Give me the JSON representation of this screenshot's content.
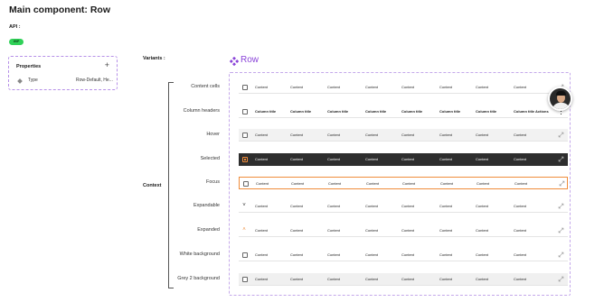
{
  "header": {
    "title": "Main component: Row",
    "api_label": "API :",
    "api_badge": "WIP"
  },
  "properties": {
    "title": "Properties",
    "add_icon": "plus-icon",
    "items": [
      {
        "key": "Type",
        "value": "Row-Default, He..."
      }
    ]
  },
  "variants": {
    "label": "Variants :",
    "component_title": "Row",
    "component_icon": "component-diamond-icon"
  },
  "context_label": "Context",
  "rows": [
    {
      "label": "Content cells",
      "type": "default"
    },
    {
      "label": "Column headers",
      "type": "header"
    },
    {
      "label": "Hover",
      "type": "hover"
    },
    {
      "label": "Selected",
      "type": "selected"
    },
    {
      "label": "Focus",
      "type": "focus"
    },
    {
      "label": "Expandable",
      "type": "expandable"
    },
    {
      "label": "Expanded",
      "type": "expanded"
    },
    {
      "label": "White background",
      "type": "white"
    },
    {
      "label": "Grey 2 background",
      "type": "grey"
    }
  ],
  "cell_text": "Content",
  "header_text": "Column title",
  "actions_text": "Actions",
  "colors": {
    "accent_purple": "#8a44d8",
    "focus_orange": "#f08c3a",
    "selected_bg": "#2e2e2e",
    "wip_green": "#30d158"
  }
}
